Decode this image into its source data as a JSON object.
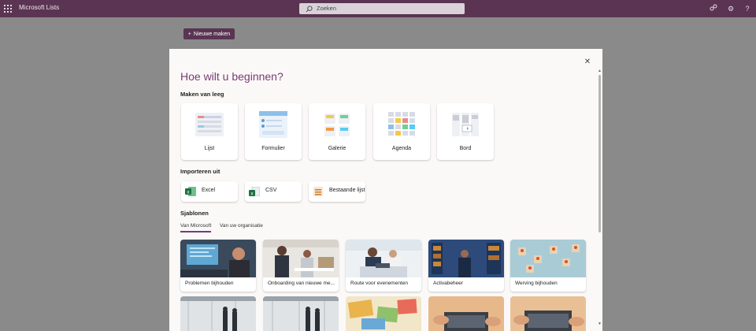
{
  "app": {
    "title": "Microsoft Lists"
  },
  "search": {
    "placeholder": "Zoeken"
  },
  "page": {
    "new_button": "Nieuwe maken"
  },
  "dialog": {
    "title": "Hoe wilt u beginnen?",
    "create_section": "Maken van leeg",
    "create_options": [
      "Lijst",
      "Formulier",
      "Galerie",
      "Agenda",
      "Bord"
    ],
    "import_section": "Importeren uit",
    "import_options": [
      "Excel",
      "CSV",
      "Bestaande lijst"
    ],
    "templates_section": "Sjablonen",
    "tabs": [
      "Van Microsoft",
      "Van uw organisatie"
    ],
    "active_tab": "Van Microsoft",
    "templates": [
      "Problemen bijhouden",
      "Onboarding van nieuwe me...",
      "Route voor evenementen",
      "Activabeheer",
      "Werving bijhouden"
    ]
  },
  "icons": [
    "waffle-icon",
    "search-icon",
    "share-icon",
    "gear-icon",
    "help-icon",
    "close-icon",
    "plus-icon"
  ],
  "colors": {
    "brand": "#5a3452",
    "title": "#7a3a74",
    "excel": "#1d7044"
  }
}
